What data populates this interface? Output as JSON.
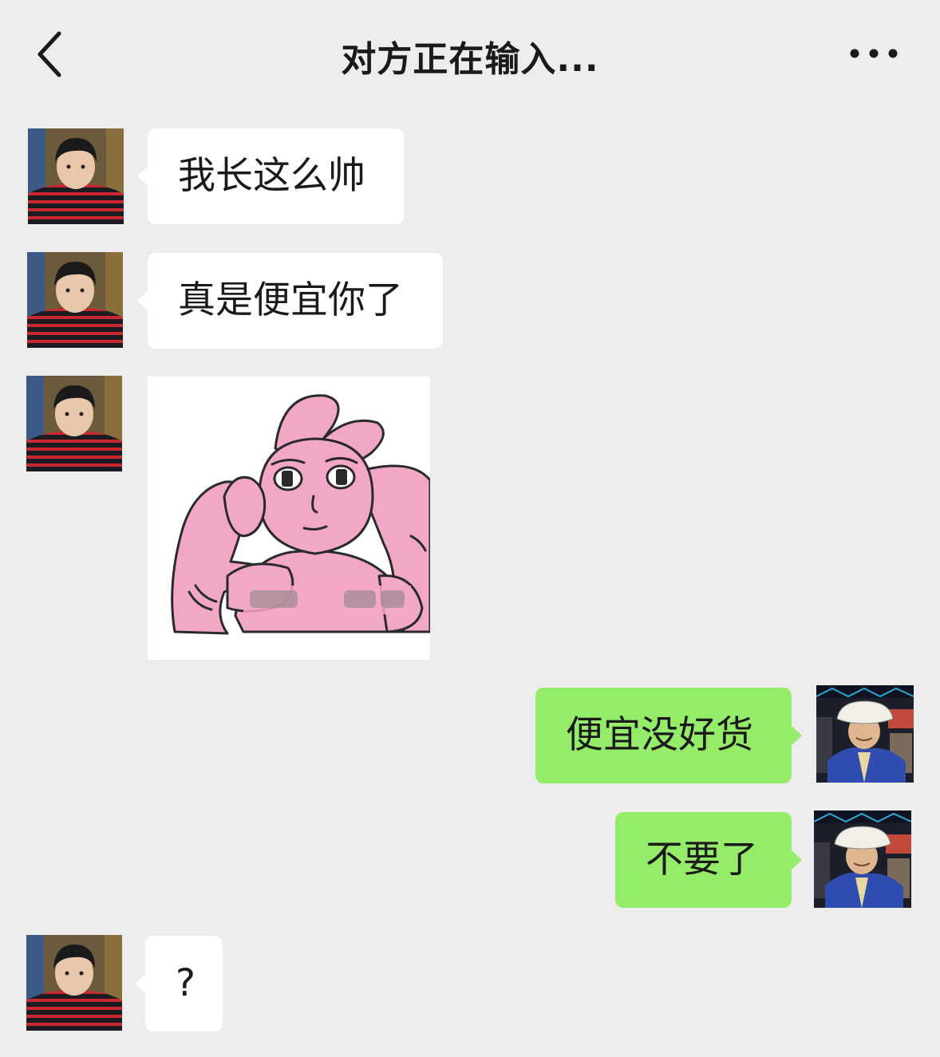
{
  "header": {
    "title": "对方正在输入...",
    "back_icon": "chevron-left-icon",
    "more_icon": "more-dots-icon"
  },
  "colors": {
    "background": "#ededed",
    "incoming_bubble": "#ffffff",
    "outgoing_bubble": "#95ec69"
  },
  "messages": [
    {
      "sender": "other",
      "type": "text",
      "text": "我长这么帅"
    },
    {
      "sender": "other",
      "type": "text",
      "text": "真是便宜你了"
    },
    {
      "sender": "other",
      "type": "sticker",
      "sticker": "pink-muscle-bunny-sticker"
    },
    {
      "sender": "me",
      "type": "text",
      "text": "便宜没好货"
    },
    {
      "sender": "me",
      "type": "text",
      "text": "不要了"
    },
    {
      "sender": "other",
      "type": "text",
      "text": "?"
    }
  ]
}
